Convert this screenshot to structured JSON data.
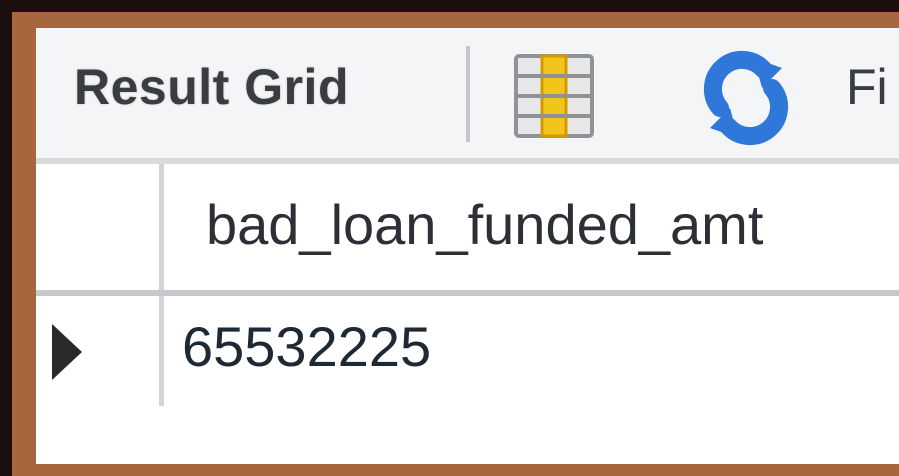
{
  "toolbar": {
    "title": "Result Grid",
    "truncated_label": "Fi",
    "icons": {
      "grid": "grid-icon",
      "refresh": "refresh-icon"
    }
  },
  "table": {
    "columns": [
      "bad_loan_funded_amt"
    ],
    "rows": [
      [
        "65532225"
      ]
    ]
  },
  "colors": {
    "outer_border": "#a8663e",
    "toolbar_bg": "#f4f5f7",
    "grid_icon_accent": "#f0c419",
    "refresh_icon": "#2f77d9"
  }
}
